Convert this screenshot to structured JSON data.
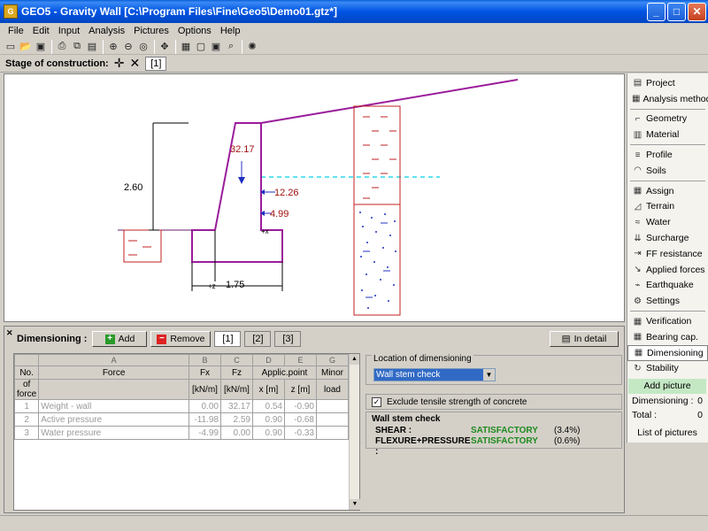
{
  "window": {
    "title": "GEO5 - Gravity Wall [C:\\Program Files\\Fine\\Geo5\\Demo01.gtz*]"
  },
  "menu": [
    "File",
    "Edit",
    "Input",
    "Analysis",
    "Pictures",
    "Options",
    "Help"
  ],
  "stage": {
    "label": "Stage of construction:",
    "tab": "[1]"
  },
  "drawing": {
    "height_label": "2.60",
    "width_label": "1.75",
    "force_fz": "32.17",
    "force_active": "12.26",
    "force_water": "4.99",
    "axis_x": "+x",
    "axis_z": "+z"
  },
  "sidebar": {
    "items": [
      {
        "label": "Project",
        "icon": "project-icon"
      },
      {
        "label": "Analysis methods",
        "icon": "methods-icon"
      },
      {
        "label": "Geometry",
        "icon": "geometry-icon"
      },
      {
        "label": "Material",
        "icon": "material-icon"
      },
      {
        "label": "Profile",
        "icon": "profile-icon"
      },
      {
        "label": "Soils",
        "icon": "soils-icon"
      },
      {
        "label": "Assign",
        "icon": "assign-icon"
      },
      {
        "label": "Terrain",
        "icon": "terrain-icon"
      },
      {
        "label": "Water",
        "icon": "water-icon"
      },
      {
        "label": "Surcharge",
        "icon": "surcharge-icon"
      },
      {
        "label": "FF resistance",
        "icon": "ff-resistance-icon"
      },
      {
        "label": "Applied forces",
        "icon": "applied-forces-icon"
      },
      {
        "label": "Earthquake",
        "icon": "earthquake-icon"
      },
      {
        "label": "Settings",
        "icon": "settings-icon"
      },
      {
        "label": "Verification",
        "icon": "verification-icon"
      },
      {
        "label": "Bearing cap.",
        "icon": "bearing-icon"
      },
      {
        "label": "Dimensioning",
        "icon": "dimensioning-icon"
      },
      {
        "label": "Stability",
        "icon": "stability-icon"
      }
    ],
    "add_picture": "Add picture",
    "dimensioning_label": "Dimensioning :",
    "dimensioning_count": "0",
    "total_label": "Total :",
    "total_count": "0",
    "list_pictures": "List of pictures"
  },
  "dimensioning": {
    "label": "Dimensioning :",
    "add": "Add",
    "remove": "Remove",
    "tabs": [
      "[1]",
      "[2]",
      "[3]"
    ],
    "in_detail": "In detail"
  },
  "table": {
    "col_letters": [
      "A",
      "B",
      "C",
      "D",
      "E",
      "G"
    ],
    "header1": [
      "No.",
      "Force",
      "Fx",
      "Fz",
      "Applic.point",
      "Minor"
    ],
    "header2": [
      "of force",
      "",
      "[kN/m]",
      "[kN/m]",
      "x [m]",
      "z [m]",
      "load"
    ],
    "rows": [
      {
        "no": "1",
        "force": "Weight - wall",
        "fx": "0.00",
        "fz": "32.17",
        "x": "0.54",
        "z": "-0.90",
        "minor": ""
      },
      {
        "no": "2",
        "force": "Active pressure",
        "fx": "-11.98",
        "fz": "2.59",
        "x": "0.90",
        "z": "-0.68",
        "minor": ""
      },
      {
        "no": "3",
        "force": "Water pressure",
        "fx": "-4.99",
        "fz": "0.00",
        "x": "0.90",
        "z": "-0.33",
        "minor": ""
      }
    ]
  },
  "location": {
    "legend": "Location of dimensioning",
    "selected": "Wall stem check"
  },
  "exclude": {
    "label": "Exclude tensile strength of concrete",
    "checked": "✓"
  },
  "wall_stem": {
    "title": "Wall stem check",
    "rows": [
      {
        "label": "SHEAR :",
        "status": "SATISFACTORY",
        "pct": "(3.4%)"
      },
      {
        "label": "FLEXURE+PRESSURE :",
        "status": "SATISFACTORY",
        "pct": "(0.6%)"
      }
    ]
  }
}
